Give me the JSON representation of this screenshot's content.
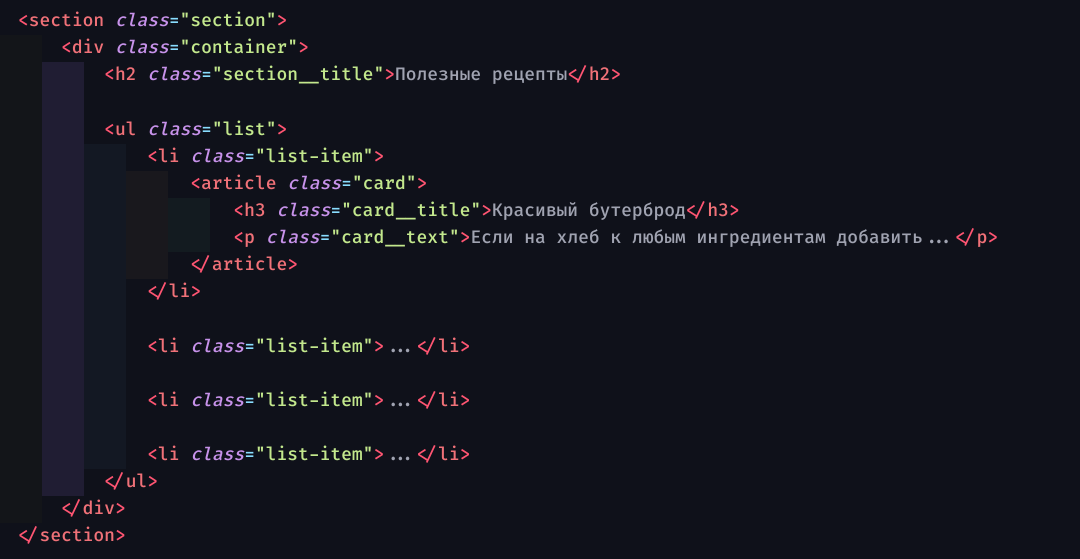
{
  "lines": [
    {
      "indent": 0,
      "maxGuide": -1,
      "tokens": [
        {
          "c": "brk",
          "t": "<"
        },
        {
          "c": "tag",
          "t": "section"
        },
        {
          "c": "txt",
          "t": " "
        },
        {
          "c": "attr",
          "t": "class"
        },
        {
          "c": "eq",
          "t": "="
        },
        {
          "c": "str",
          "t": "\"section\""
        },
        {
          "c": "brk",
          "t": ">"
        }
      ]
    },
    {
      "indent": 1,
      "maxGuide": 0,
      "tokens": [
        {
          "c": "brk",
          "t": "<"
        },
        {
          "c": "tag",
          "t": "div"
        },
        {
          "c": "txt",
          "t": " "
        },
        {
          "c": "attr",
          "t": "class"
        },
        {
          "c": "eq",
          "t": "="
        },
        {
          "c": "str",
          "t": "\"container\""
        },
        {
          "c": "brk",
          "t": ">"
        }
      ]
    },
    {
      "indent": 2,
      "maxGuide": 1,
      "tokens": [
        {
          "c": "brk",
          "t": "<"
        },
        {
          "c": "tag",
          "t": "h2"
        },
        {
          "c": "txt",
          "t": " "
        },
        {
          "c": "attr",
          "t": "class"
        },
        {
          "c": "eq",
          "t": "="
        },
        {
          "c": "str",
          "t": "\"section__title\""
        },
        {
          "c": "brk",
          "t": ">"
        },
        {
          "c": "txt",
          "t": "Полезные рецепты"
        },
        {
          "c": "brk",
          "t": "</"
        },
        {
          "c": "tag",
          "t": "h2"
        },
        {
          "c": "brk",
          "t": ">"
        }
      ]
    },
    {
      "indent": 0,
      "maxGuide": 1,
      "blank": true,
      "tokens": []
    },
    {
      "indent": 2,
      "maxGuide": 1,
      "tokens": [
        {
          "c": "brk",
          "t": "<"
        },
        {
          "c": "tag",
          "t": "ul"
        },
        {
          "c": "txt",
          "t": " "
        },
        {
          "c": "attr",
          "t": "class"
        },
        {
          "c": "eq",
          "t": "="
        },
        {
          "c": "str",
          "t": "\"list\""
        },
        {
          "c": "brk",
          "t": ">"
        }
      ]
    },
    {
      "indent": 3,
      "maxGuide": 2,
      "tokens": [
        {
          "c": "brk",
          "t": "<"
        },
        {
          "c": "tag",
          "t": "li"
        },
        {
          "c": "txt",
          "t": " "
        },
        {
          "c": "attr",
          "t": "class"
        },
        {
          "c": "eq",
          "t": "="
        },
        {
          "c": "str",
          "t": "\"list-item\""
        },
        {
          "c": "brk",
          "t": ">"
        }
      ]
    },
    {
      "indent": 4,
      "maxGuide": 3,
      "tokens": [
        {
          "c": "brk",
          "t": "<"
        },
        {
          "c": "tag",
          "t": "article"
        },
        {
          "c": "txt",
          "t": " "
        },
        {
          "c": "attr",
          "t": "class"
        },
        {
          "c": "eq",
          "t": "="
        },
        {
          "c": "str",
          "t": "\"card\""
        },
        {
          "c": "brk",
          "t": ">"
        }
      ]
    },
    {
      "indent": 5,
      "maxGuide": 4,
      "tokens": [
        {
          "c": "brk",
          "t": "<"
        },
        {
          "c": "tag",
          "t": "h3"
        },
        {
          "c": "txt",
          "t": " "
        },
        {
          "c": "attr",
          "t": "class"
        },
        {
          "c": "eq",
          "t": "="
        },
        {
          "c": "str",
          "t": "\"card__title\""
        },
        {
          "c": "brk",
          "t": ">"
        },
        {
          "c": "txt",
          "t": "Красивый бутерброд"
        },
        {
          "c": "brk",
          "t": "</"
        },
        {
          "c": "tag",
          "t": "h3"
        },
        {
          "c": "brk",
          "t": ">"
        }
      ]
    },
    {
      "indent": 5,
      "maxGuide": 4,
      "tokens": [
        {
          "c": "brk",
          "t": "<"
        },
        {
          "c": "tag",
          "t": "p"
        },
        {
          "c": "txt",
          "t": " "
        },
        {
          "c": "attr",
          "t": "class"
        },
        {
          "c": "eq",
          "t": "="
        },
        {
          "c": "str",
          "t": "\"card__text\""
        },
        {
          "c": "brk",
          "t": ">"
        },
        {
          "c": "txt",
          "t": "Если на хлеб к любым ингредиентам добавить..."
        },
        {
          "c": "brk",
          "t": "</"
        },
        {
          "c": "tag",
          "t": "p"
        },
        {
          "c": "brk",
          "t": ">"
        }
      ]
    },
    {
      "indent": 4,
      "maxGuide": 3,
      "tokens": [
        {
          "c": "brk",
          "t": "</"
        },
        {
          "c": "tag",
          "t": "article"
        },
        {
          "c": "brk",
          "t": ">"
        }
      ]
    },
    {
      "indent": 3,
      "maxGuide": 2,
      "tokens": [
        {
          "c": "brk",
          "t": "</"
        },
        {
          "c": "tag",
          "t": "li"
        },
        {
          "c": "brk",
          "t": ">"
        }
      ]
    },
    {
      "indent": 0,
      "maxGuide": 2,
      "blank": true,
      "tokens": []
    },
    {
      "indent": 3,
      "maxGuide": 2,
      "tokens": [
        {
          "c": "brk",
          "t": "<"
        },
        {
          "c": "tag",
          "t": "li"
        },
        {
          "c": "txt",
          "t": " "
        },
        {
          "c": "attr",
          "t": "class"
        },
        {
          "c": "eq",
          "t": "="
        },
        {
          "c": "str",
          "t": "\"list-item\""
        },
        {
          "c": "brk",
          "t": ">"
        },
        {
          "c": "txt",
          "t": "..."
        },
        {
          "c": "brk",
          "t": "</"
        },
        {
          "c": "tag",
          "t": "li"
        },
        {
          "c": "brk",
          "t": ">"
        }
      ]
    },
    {
      "indent": 0,
      "maxGuide": 2,
      "blank": true,
      "tokens": []
    },
    {
      "indent": 3,
      "maxGuide": 2,
      "tokens": [
        {
          "c": "brk",
          "t": "<"
        },
        {
          "c": "tag",
          "t": "li"
        },
        {
          "c": "txt",
          "t": " "
        },
        {
          "c": "attr",
          "t": "class"
        },
        {
          "c": "eq",
          "t": "="
        },
        {
          "c": "str",
          "t": "\"list-item\""
        },
        {
          "c": "brk",
          "t": ">"
        },
        {
          "c": "txt",
          "t": "..."
        },
        {
          "c": "brk",
          "t": "</"
        },
        {
          "c": "tag",
          "t": "li"
        },
        {
          "c": "brk",
          "t": ">"
        }
      ]
    },
    {
      "indent": 0,
      "maxGuide": 2,
      "blank": true,
      "tokens": []
    },
    {
      "indent": 3,
      "maxGuide": 2,
      "tokens": [
        {
          "c": "brk",
          "t": "<"
        },
        {
          "c": "tag",
          "t": "li"
        },
        {
          "c": "txt",
          "t": " "
        },
        {
          "c": "attr",
          "t": "class"
        },
        {
          "c": "eq",
          "t": "="
        },
        {
          "c": "str",
          "t": "\"list-item\""
        },
        {
          "c": "brk",
          "t": ">"
        },
        {
          "c": "txt",
          "t": "..."
        },
        {
          "c": "brk",
          "t": "</"
        },
        {
          "c": "tag",
          "t": "li"
        },
        {
          "c": "brk",
          "t": ">"
        }
      ]
    },
    {
      "indent": 2,
      "maxGuide": 1,
      "tokens": [
        {
          "c": "brk",
          "t": "</"
        },
        {
          "c": "tag",
          "t": "ul"
        },
        {
          "c": "brk",
          "t": ">"
        }
      ]
    },
    {
      "indent": 1,
      "maxGuide": 0,
      "tokens": [
        {
          "c": "brk",
          "t": "</"
        },
        {
          "c": "tag",
          "t": "div"
        },
        {
          "c": "brk",
          "t": ">"
        }
      ]
    },
    {
      "indent": 0,
      "maxGuide": -1,
      "tokens": [
        {
          "c": "brk",
          "t": "</"
        },
        {
          "c": "tag",
          "t": "section"
        },
        {
          "c": "brk",
          "t": ">"
        }
      ]
    }
  ],
  "guidePalette": [
    "c0",
    "c1",
    "c2",
    "c3",
    "c4"
  ],
  "indentUnit": "    "
}
